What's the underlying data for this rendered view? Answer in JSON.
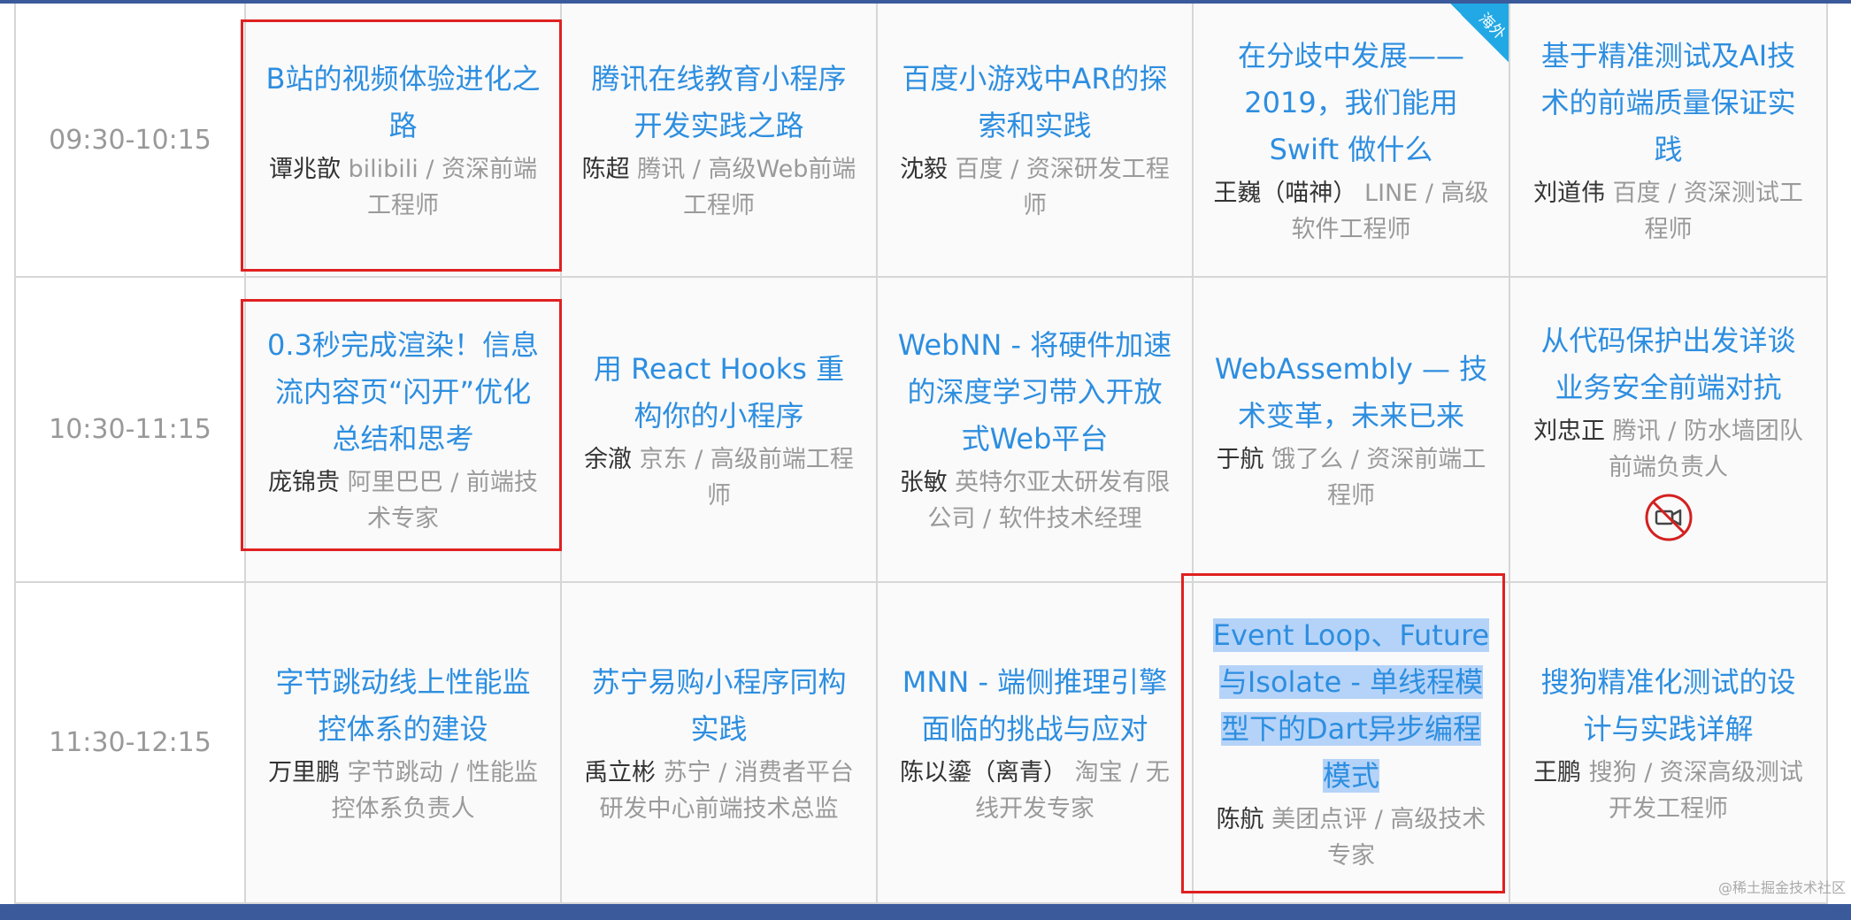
{
  "watermark": "@稀土掘金技术社区",
  "badge_label": "海外",
  "rows": [
    {
      "time": "09:30-10:15",
      "talks": [
        {
          "title": "B站的视频体验进化之路",
          "speaker": "谭兆歆",
          "org": "bilibili / 资深前端工程师"
        },
        {
          "title": "腾讯在线教育小程序开发实践之路",
          "speaker": "陈超",
          "org": "腾讯 / 高级Web前端工程师"
        },
        {
          "title": "百度小游戏中AR的探索和实践",
          "speaker": "沈毅",
          "org": "百度 / 资深研发工程师"
        },
        {
          "title": "在分歧中发展——2019，我们能用 Swift 做什么",
          "speaker": "王巍（喵神）",
          "org": "LINE / 高级软件工程师"
        },
        {
          "title": "基于精准测试及AI技术的前端质量保证实践",
          "speaker": "刘道伟",
          "org": "百度 / 资深测试工程师"
        }
      ]
    },
    {
      "time": "10:30-11:15",
      "talks": [
        {
          "title": "0.3秒完成渲染！信息流内容页“闪开”优化总结和思考",
          "speaker": "庞锦贵",
          "org": "阿里巴巴 / 前端技术专家"
        },
        {
          "title": "用 React Hooks 重构你的小程序",
          "speaker": "余澈",
          "org": "京东 / 高级前端工程师"
        },
        {
          "title": "WebNN - 将硬件加速的深度学习带入开放式Web平台",
          "speaker": "张敏",
          "org": "英特尔亚太研发有限公司 / 软件技术经理"
        },
        {
          "title": "WebAssembly — 技术变革，未来已来",
          "speaker": "于航",
          "org": "饿了么 / 资深前端工程师"
        },
        {
          "title": "从代码保护出发详谈业务安全前端对抗",
          "speaker": "刘忠正",
          "org": "腾讯 / 防水墙团队前端负责人"
        }
      ]
    },
    {
      "time": "11:30-12:15",
      "talks": [
        {
          "title": "字节跳动线上性能监控体系的建设",
          "speaker": "万里鹏",
          "org": "字节跳动 / 性能监控体系负责人"
        },
        {
          "title": "苏宁易购小程序同构实践",
          "speaker": "禹立彬",
          "org": "苏宁 / 消费者平台研发中心前端技术总监"
        },
        {
          "title": "MNN - 端侧推理引擎面临的挑战与应对",
          "speaker": "陈以鎏（离青）",
          "org": "淘宝 / 无线开发专家"
        },
        {
          "title": "Event Loop、Future与Isolate - 单线程模型下的Dart异步编程模式",
          "speaker": "陈航",
          "org": "美团点评 / 高级技术专家"
        },
        {
          "title": "搜狗精准化测试的设计与实践详解",
          "speaker": "王鹏",
          "org": "搜狗 / 资深高级测试开发工程师"
        }
      ]
    }
  ],
  "icons": {
    "no_video": "no-video-icon"
  },
  "colors": {
    "title": "#2d8ee0",
    "header_bar": "#3a5a9c",
    "highlight_box": "#e02020",
    "selection": "#b5d3f8",
    "badge": "#22a8e4"
  }
}
